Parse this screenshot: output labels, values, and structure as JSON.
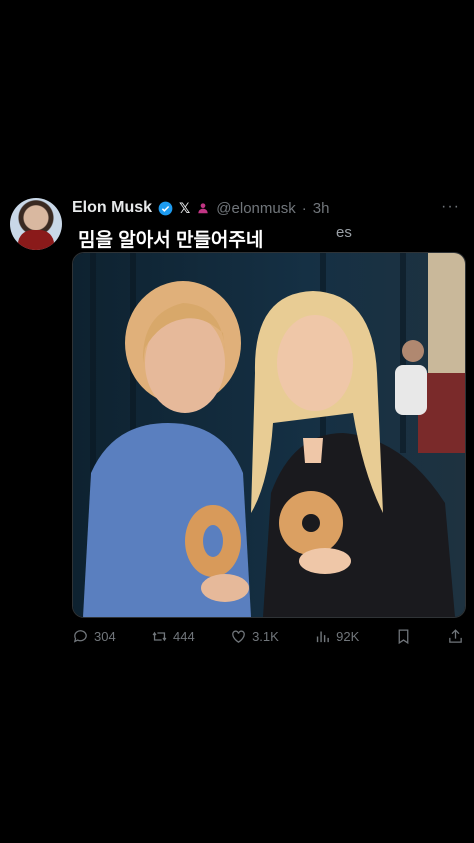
{
  "tweet": {
    "author_name": "Elon Musk",
    "x_logo": "𝕏",
    "handle": "@elonmusk",
    "separator": "·",
    "time": "3h",
    "more": "···",
    "caption": "밈을 알아서 만들어주네",
    "caption_overflow": "es",
    "icons": {
      "verified": "verified-badge-icon",
      "affiliate": "person-badge-icon"
    },
    "colors": {
      "verified": "#1d9bf0",
      "affiliate": "#c13584",
      "muted": "#71767b"
    }
  },
  "actions": {
    "replies": "304",
    "reposts": "444",
    "likes": "3.1K",
    "views": "92K"
  }
}
